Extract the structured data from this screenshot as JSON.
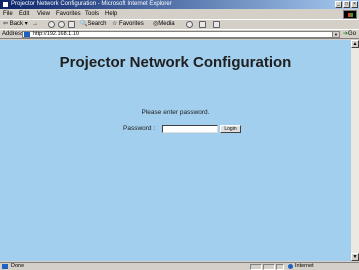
{
  "window": {
    "title": "Projector Network Configuration - Microsoft Internet Explorer",
    "controls": [
      "_",
      "□",
      "×"
    ]
  },
  "menu": [
    "File",
    "Edit",
    "View",
    "Favorites",
    "Tools",
    "Help"
  ],
  "toolbar": {
    "back_label": "Back",
    "forward_label": "→",
    "search_label": "Search",
    "favorites_label": "Favorites",
    "media_label": "Media"
  },
  "address": {
    "label": "Address",
    "value": "http://192.168.1.10",
    "go_label": "Go"
  },
  "page": {
    "heading": "Projector Network Configuration",
    "prompt": "Please enter password.",
    "password_label": "Password :",
    "password_value": "",
    "login_label": "Login"
  },
  "status": {
    "text": "Done",
    "zone": "Internet"
  },
  "colors": {
    "content_bg": "#a3cfee",
    "titlebar": "#0a246a"
  }
}
